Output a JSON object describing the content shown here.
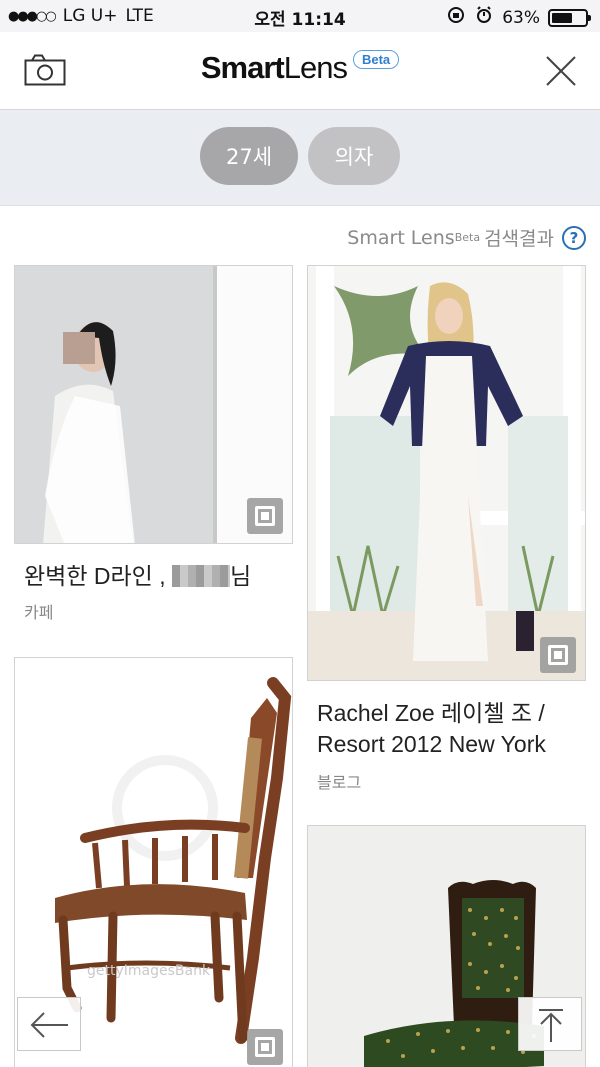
{
  "status_bar": {
    "carrier": "LG U+",
    "network": "LTE",
    "time": "오전 11:14",
    "battery": "63%",
    "battery_level": 0.63
  },
  "header": {
    "logo_bold": "Smart",
    "logo_light": "Lens",
    "beta_badge": "Beta",
    "icons": {
      "camera": "camera-icon",
      "close": "close-icon"
    }
  },
  "tags": [
    {
      "label": "27세",
      "selected": true
    },
    {
      "label": "의자",
      "selected": false
    }
  ],
  "results": {
    "title_prefix": "Smart Lens",
    "title_superscript": "Beta",
    "title_suffix": "검색결과",
    "help_label": "?"
  },
  "cards": [
    {
      "title_start": "완벽한 D라인 ,",
      "title_end": "님",
      "source": "카페"
    },
    {
      "title": "Rachel Zoe 레이첼 조 /",
      "title_line2": "Resort 2012 New York",
      "source": "블로그"
    },
    {
      "title": "",
      "source": "",
      "watermark": "gettyImagesBank"
    },
    {
      "title": "",
      "source": ""
    }
  ],
  "floating": {
    "back_icon": "arrow-left-icon",
    "top_icon": "arrow-up-icon"
  },
  "colors": {
    "accent": "#2a6fb5",
    "beta": "#2e7fd0",
    "tag_selected": "#a7a7a9",
    "tag_normal": "#c2c2c4",
    "tag_bar": "#eaedf2"
  }
}
